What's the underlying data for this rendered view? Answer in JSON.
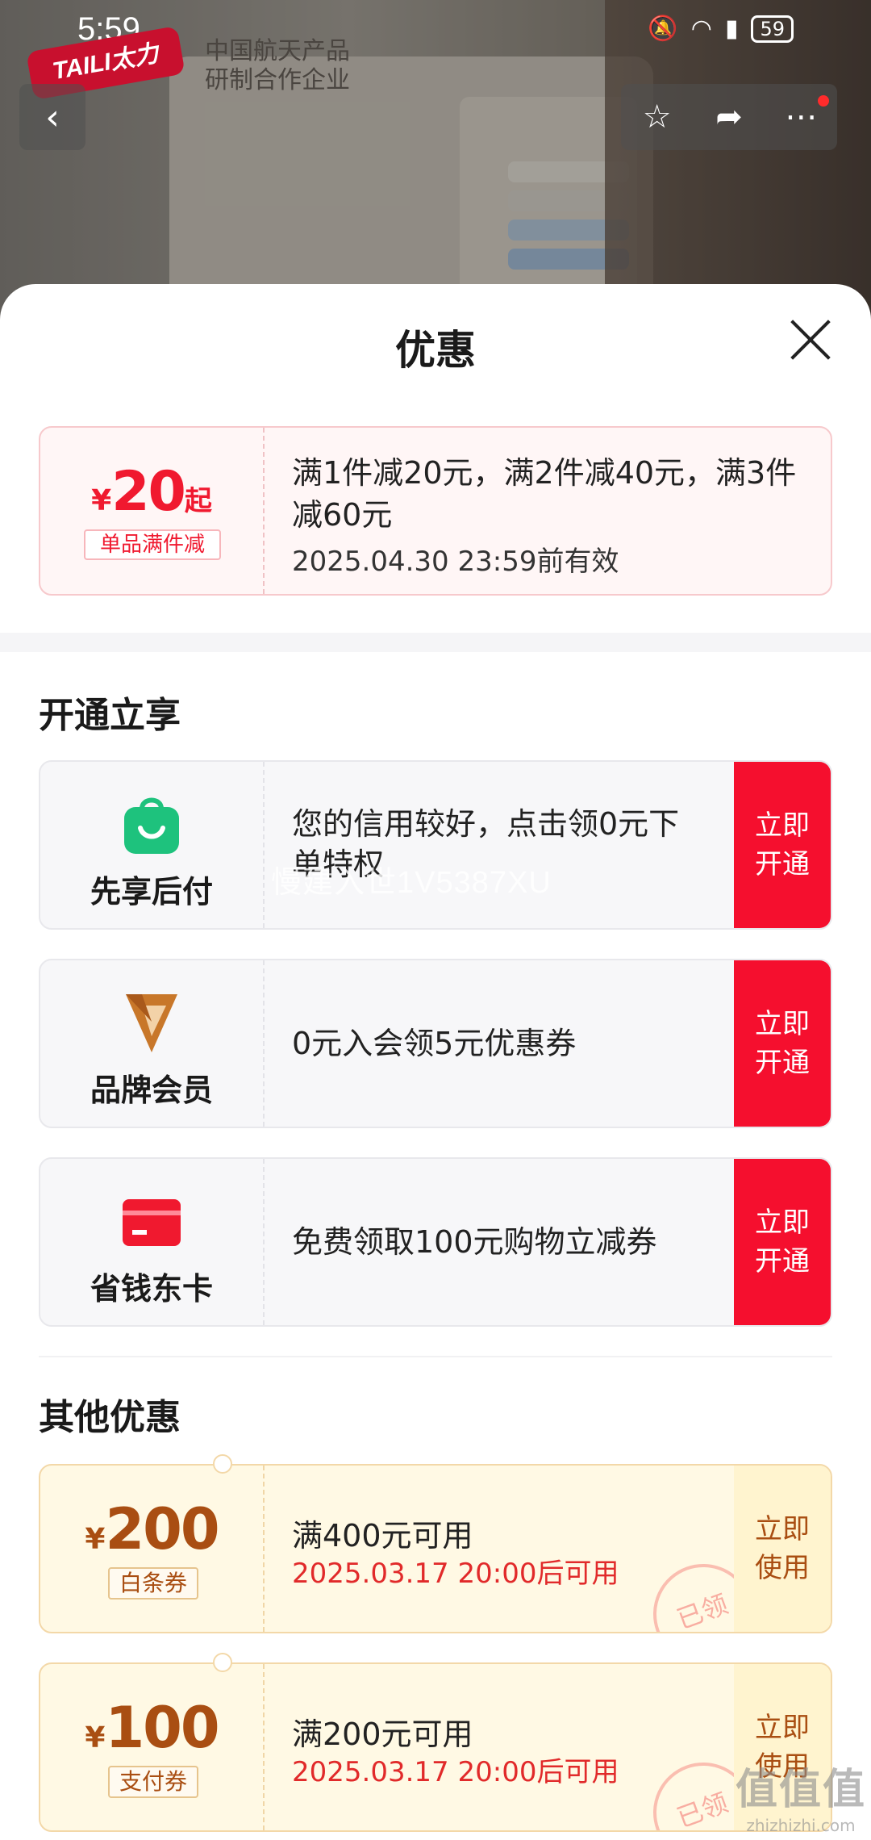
{
  "status_bar": {
    "time": "5:59",
    "battery": "59"
  },
  "brand": {
    "logo_text": "TAILI太力",
    "line1": "中国航天产品",
    "line2": "研制合作企业"
  },
  "sheet": {
    "title": "优惠",
    "top_coupon": {
      "currency": "¥",
      "amount": "20",
      "suffix": "起",
      "tag": "单品满件减",
      "description": "满1件减20元，满2件减40元，满3件减60元",
      "validity": "2025.04.30 23:59前有效"
    },
    "section_open": "开通立享",
    "perks": [
      {
        "name": "先享后付",
        "text": "您的信用较好，点击领0元下单特权",
        "btn1": "立即",
        "btn2": "开通",
        "icon": "shopping-bag-icon",
        "color": "#1ec27d"
      },
      {
        "name": "品牌会员",
        "text": "0元入会领5元优惠券",
        "btn1": "立即",
        "btn2": "开通",
        "icon": "v-brand-icon",
        "color": "#c8772a"
      },
      {
        "name": "省钱东卡",
        "text": "免费领取100元购物立减券",
        "btn1": "立即",
        "btn2": "开通",
        "icon": "card-icon",
        "color": "#f0192f"
      }
    ],
    "section_other": "其他优惠",
    "tickets": [
      {
        "currency": "¥",
        "amount": "200",
        "tag": "白条券",
        "condition": "满400元可用",
        "date": "2025.03.17 20:00后可用",
        "btn1": "立即",
        "btn2": "使用",
        "stamp": "已领"
      },
      {
        "currency": "¥",
        "amount": "100",
        "tag": "支付券",
        "condition": "满200元可用",
        "date": "2025.03.17 20:00后可用",
        "btn1": "立即",
        "btn2": "使用",
        "stamp": "已领"
      }
    ]
  },
  "watermark": "慢建入世1V5387XU",
  "site_mark": {
    "big": "值值值",
    "small": "zhizhizhi.com"
  }
}
